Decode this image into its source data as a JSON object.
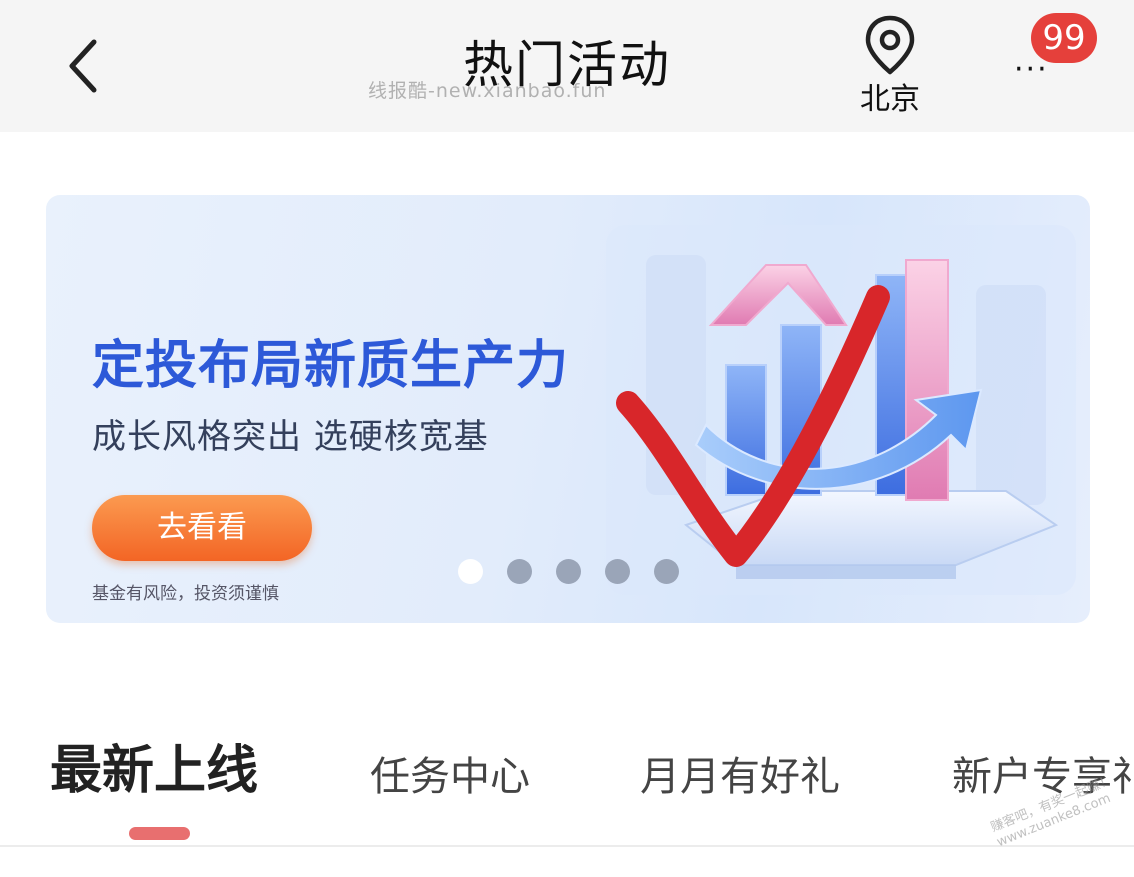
{
  "header": {
    "title": "热门活动",
    "watermark": "线报酷-new.xianbao.fun",
    "location": "北京",
    "more_dots": "···",
    "badge_count": "99",
    "icons": {
      "back": "chevron-left-icon",
      "location": "map-pin-icon",
      "more": "more-dots-icon"
    }
  },
  "banner": {
    "title": "定投布局新质生产力",
    "subtitle": "成长风格突出 选硬核宽基",
    "cta_label": "去看看",
    "risk_note": "基金有风险，投资须谨慎",
    "slide_count": 5,
    "active_slide": 1
  },
  "tabs": [
    {
      "label": "最新上线",
      "active": true
    },
    {
      "label": "任务中心",
      "active": false
    },
    {
      "label": "月月有好礼",
      "active": false
    },
    {
      "label": "新户专享礼",
      "active": false
    }
  ],
  "corner_watermark": {
    "line1": "赚客吧，有奖一起赚！",
    "line2": "www.zuanke8.com"
  },
  "colors": {
    "accent": "#e5403b",
    "banner_title": "#2d59d8",
    "cta": "#f36525",
    "tab_indicator": "#e86f6f"
  }
}
